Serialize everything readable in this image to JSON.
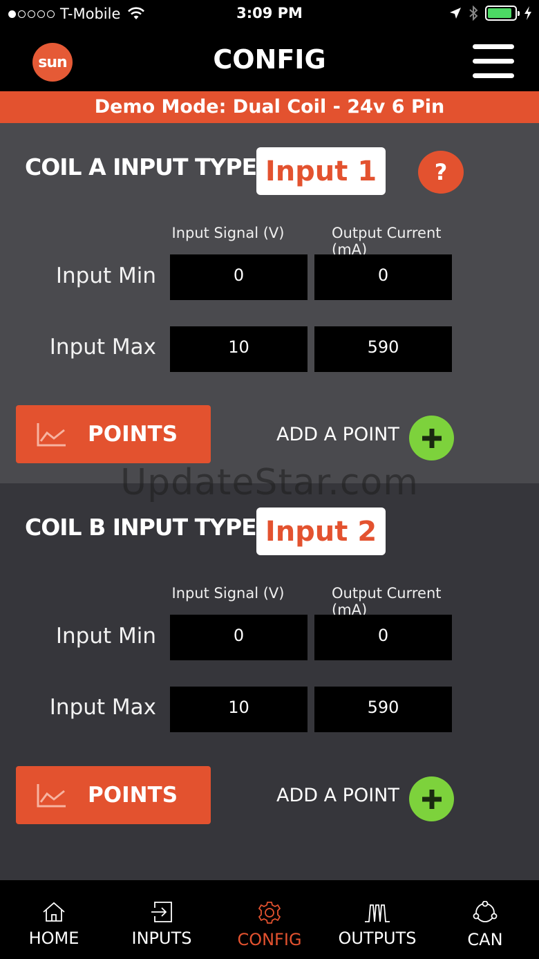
{
  "status_bar": {
    "carrier": "T-Mobile",
    "time": "3:09 PM",
    "signal_dots_filled": 1,
    "signal_dots_total": 5,
    "battery_level": 0.9
  },
  "header": {
    "logo_text": "sun",
    "title": "CONFIG"
  },
  "banner": {
    "text": "Demo Mode: Dual Coil - 24v 6 Pin"
  },
  "coils": [
    {
      "title": "COIL A INPUT TYPE:",
      "input_type": "Input 1",
      "help_label": "?",
      "col_signal": "Input Signal (V)",
      "col_current": "Output Current (mA)",
      "min_label": "Input Min",
      "max_label": "Input Max",
      "min_signal": "0",
      "min_current": "0",
      "max_signal": "10",
      "max_current": "590",
      "points_label": "POINTS",
      "add_point_label": "ADD A POINT"
    },
    {
      "title": "COIL B INPUT TYPE:",
      "input_type": "Input 2",
      "col_signal": "Input Signal (V)",
      "col_current": "Output Current (mA)",
      "min_label": "Input Min",
      "max_label": "Input Max",
      "min_signal": "0",
      "min_current": "0",
      "max_signal": "10",
      "max_current": "590",
      "points_label": "POINTS",
      "add_point_label": "ADD A POINT"
    }
  ],
  "watermark": "UpdateStar.com",
  "tabs": [
    {
      "label": "HOME",
      "icon": "home-icon"
    },
    {
      "label": "INPUTS",
      "icon": "input-icon"
    },
    {
      "label": "CONFIG",
      "icon": "gear-icon",
      "active": true
    },
    {
      "label": "OUTPUTS",
      "icon": "waveform-icon"
    },
    {
      "label": "CAN",
      "icon": "network-icon"
    }
  ],
  "colors": {
    "accent": "#e3522f",
    "add": "#7dd23c",
    "coil_a_bg": "#4a4a4e",
    "coil_b_bg": "#36363b",
    "battery": "#4cd964"
  }
}
